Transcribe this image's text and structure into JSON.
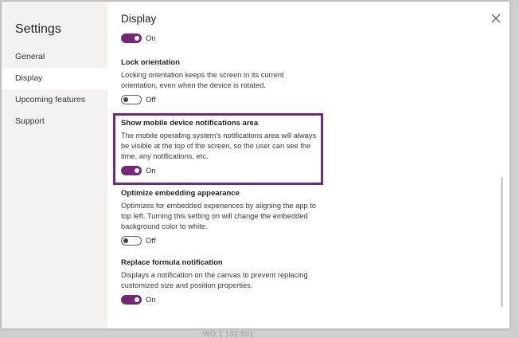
{
  "sidebar": {
    "title": "Settings",
    "items": [
      {
        "label": "General"
      },
      {
        "label": "Display"
      },
      {
        "label": "Upcoming features"
      },
      {
        "label": "Support"
      }
    ]
  },
  "main": {
    "title": "Display",
    "top_toggle": {
      "label": "On",
      "state": "on"
    },
    "settings": [
      {
        "title": "Lock orientation",
        "description": "Locking orientation keeps the screen in its current orientation, even when the device is rotated.",
        "toggle_label": "Off"
      },
      {
        "title": "Show mobile device notifications area",
        "description": "The mobile operating system's notifications area will always be visible at the top of the screen, so the user can see the time, any notifications, etc.",
        "toggle_label": "On"
      },
      {
        "title": "Optimize embedding appearance",
        "description": "Optimizes for embedded experiences by aligning the app to top left. Turning this setting on will change the embedded background color to white.",
        "toggle_label": "Off"
      },
      {
        "title": "Replace formula notification",
        "description": "Displays a notification on the canvas to prevent replacing customized size and position properties.",
        "toggle_label": "On"
      }
    ]
  },
  "colors": {
    "accent": "#742774",
    "highlight_border": "#6b2a7e",
    "sidebar_bg": "#f3f2f1"
  },
  "icons": {
    "close": "close-icon"
  }
}
